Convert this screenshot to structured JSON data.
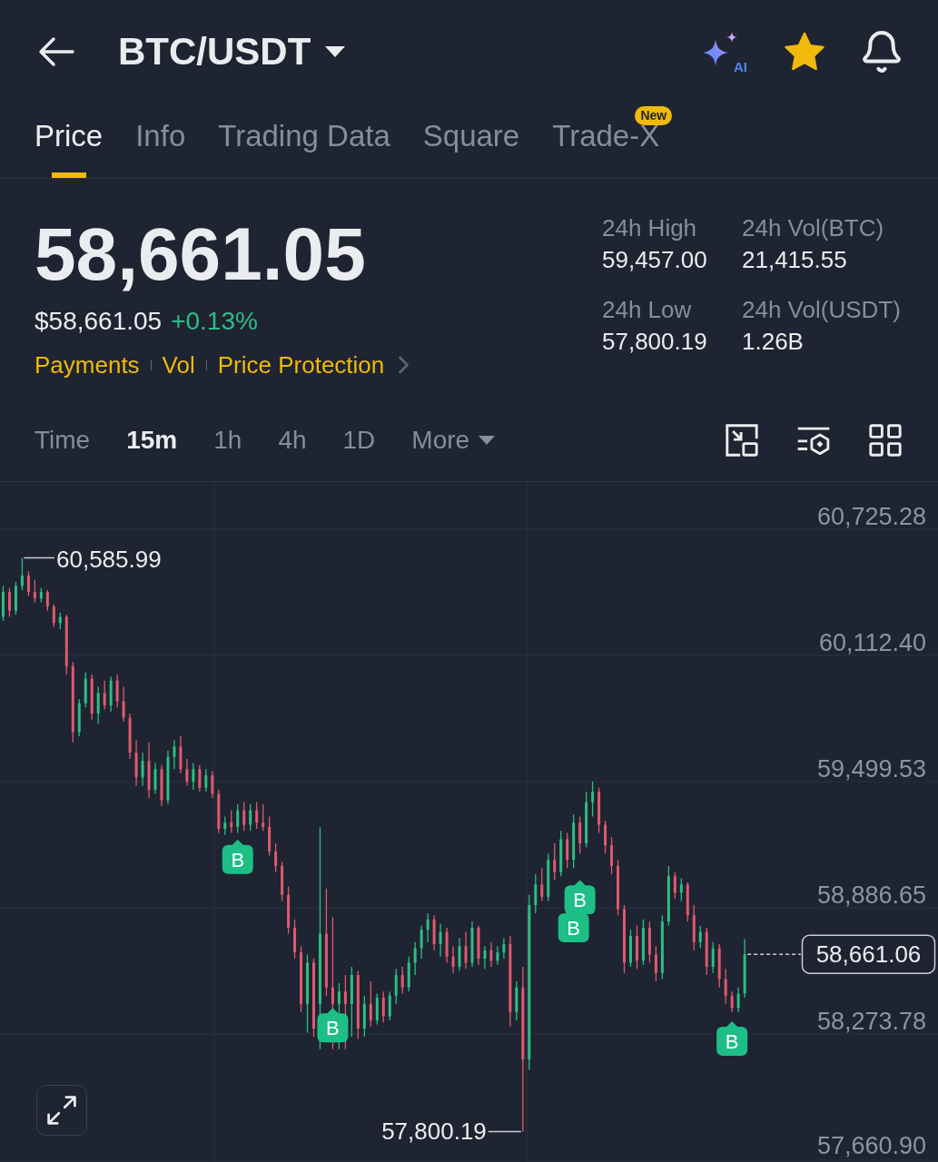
{
  "header": {
    "pair": "BTC/USDT",
    "ai_label": "AI",
    "favorite": true
  },
  "tabs": [
    {
      "label": "Price",
      "selected": true
    },
    {
      "label": "Info",
      "selected": false
    },
    {
      "label": "Trading Data",
      "selected": false
    },
    {
      "label": "Square",
      "selected": false
    },
    {
      "label": "Trade-X",
      "selected": false,
      "badge": "New"
    }
  ],
  "ticker": {
    "last_price": "58,661.05",
    "usd_price": "$58,661.05",
    "change": "+0.13%"
  },
  "links": [
    "Payments",
    "Vol",
    "Price Protection"
  ],
  "stats": [
    {
      "label": "24h High",
      "value": "59,457.00"
    },
    {
      "label": "24h Vol(BTC)",
      "value": "21,415.55"
    },
    {
      "label": "24h Low",
      "value": "57,800.19"
    },
    {
      "label": "24h Vol(USDT)",
      "value": "1.26B"
    }
  ],
  "intervals": [
    {
      "label": "Time",
      "kind": "option",
      "selected": false
    },
    {
      "label": "15m",
      "kind": "option",
      "selected": true
    },
    {
      "label": "1h",
      "kind": "option",
      "selected": false
    },
    {
      "label": "4h",
      "kind": "option",
      "selected": false
    },
    {
      "label": "1D",
      "kind": "option",
      "selected": false
    },
    {
      "label": "More",
      "kind": "menu",
      "selected": false
    }
  ],
  "chart": {
    "chart_data": {
      "type": "candlestick",
      "grid": true,
      "ohlc": [
        [
          60300,
          60450,
          60280,
          60420
        ],
        [
          60420,
          60440,
          60300,
          60330
        ],
        [
          60330,
          60470,
          60310,
          60450
        ],
        [
          60450,
          60585.99,
          60430,
          60500
        ],
        [
          60500,
          60520,
          60400,
          60420
        ],
        [
          60420,
          60480,
          60370,
          60390
        ],
        [
          60390,
          60440,
          60370,
          60420
        ],
        [
          60420,
          60430,
          60330,
          60350
        ],
        [
          60350,
          60360,
          60250,
          60270
        ],
        [
          60270,
          60320,
          60240,
          60300
        ],
        [
          60300,
          60310,
          60020,
          60060
        ],
        [
          60060,
          60080,
          59690,
          59740
        ],
        [
          59740,
          59900,
          59720,
          59880
        ],
        [
          59880,
          60030,
          59860,
          60000
        ],
        [
          60000,
          60020,
          59800,
          59830
        ],
        [
          59830,
          59960,
          59780,
          59930
        ],
        [
          59930,
          59990,
          59850,
          59870
        ],
        [
          59870,
          60010,
          59840,
          59990
        ],
        [
          59990,
          60020,
          59860,
          59890
        ],
        [
          59890,
          59960,
          59790,
          59810
        ],
        [
          59810,
          59830,
          59610,
          59640
        ],
        [
          59640,
          59700,
          59480,
          59520
        ],
        [
          59520,
          59640,
          59480,
          59600
        ],
        [
          59600,
          59690,
          59420,
          59460
        ],
        [
          59460,
          59590,
          59440,
          59560
        ],
        [
          59560,
          59580,
          59380,
          59410
        ],
        [
          59410,
          59650,
          59390,
          59620
        ],
        [
          59620,
          59700,
          59560,
          59670
        ],
        [
          59670,
          59720,
          59540,
          59560
        ],
        [
          59560,
          59610,
          59480,
          59500
        ],
        [
          59500,
          59590,
          59460,
          59560
        ],
        [
          59560,
          59580,
          59450,
          59470
        ],
        [
          59470,
          59560,
          59450,
          59530
        ],
        [
          59530,
          59550,
          59420,
          59440
        ],
        [
          59440,
          59460,
          59250,
          59270
        ],
        [
          59270,
          59330,
          59240,
          59300
        ],
        [
          59300,
          59360,
          59250,
          59280
        ],
        [
          59280,
          59390,
          59250,
          59360
        ],
        [
          59360,
          59400,
          59260,
          59290
        ],
        [
          59290,
          59390,
          59260,
          59360
        ],
        [
          59360,
          59400,
          59270,
          59300
        ],
        [
          59300,
          59390,
          59260,
          59280
        ],
        [
          59280,
          59330,
          59140,
          59160
        ],
        [
          59160,
          59200,
          59060,
          59090
        ],
        [
          59090,
          59110,
          58920,
          58950
        ],
        [
          58950,
          58990,
          58760,
          58790
        ],
        [
          58790,
          58830,
          58640,
          58670
        ],
        [
          58670,
          58700,
          58380,
          58420
        ],
        [
          58420,
          58660,
          58280,
          58620
        ],
        [
          58620,
          58640,
          58260,
          58300
        ],
        [
          58420,
          59278,
          58200,
          58760
        ],
        [
          58760,
          58980,
          58460,
          58500
        ],
        [
          58500,
          58840,
          58200,
          58420
        ],
        [
          58420,
          58520,
          58200,
          58480
        ],
        [
          58480,
          58560,
          58200,
          58420
        ],
        [
          58420,
          58600,
          58260,
          58560
        ],
        [
          58560,
          58580,
          58250,
          58300
        ],
        [
          58300,
          58460,
          58260,
          58420
        ],
        [
          58420,
          58530,
          58310,
          58340
        ],
        [
          58340,
          58470,
          58320,
          58450
        ],
        [
          58450,
          58480,
          58330,
          58360
        ],
        [
          58360,
          58480,
          58340,
          58460
        ],
        [
          58460,
          58590,
          58420,
          58560
        ],
        [
          58560,
          58600,
          58470,
          58500
        ],
        [
          58500,
          58650,
          58480,
          58620
        ],
        [
          58620,
          58720,
          58560,
          58690
        ],
        [
          58690,
          58800,
          58640,
          58780
        ],
        [
          58780,
          58860,
          58720,
          58830
        ],
        [
          58830,
          58850,
          58680,
          58710
        ],
        [
          58710,
          58810,
          58650,
          58770
        ],
        [
          58770,
          58790,
          58620,
          58650
        ],
        [
          58650,
          58700,
          58570,
          58600
        ],
        [
          58600,
          58740,
          58580,
          58700
        ],
        [
          58700,
          58770,
          58590,
          58620
        ],
        [
          58620,
          58820,
          58600,
          58790
        ],
        [
          58790,
          58800,
          58610,
          58640
        ],
        [
          58640,
          58700,
          58590,
          58680
        ],
        [
          58680,
          58720,
          58600,
          58630
        ],
        [
          58630,
          58700,
          58610,
          58670
        ],
        [
          58670,
          58740,
          58640,
          58710
        ],
        [
          58710,
          58750,
          58310,
          58380
        ],
        [
          58380,
          58530,
          58340,
          58500
        ],
        [
          58500,
          58600,
          57800.19,
          58150
        ],
        [
          58150,
          58950,
          58100,
          58900
        ],
        [
          58900,
          59050,
          58860,
          59000
        ],
        [
          59000,
          59080,
          58920,
          58940
        ],
        [
          58940,
          59150,
          58920,
          59120
        ],
        [
          59120,
          59200,
          59020,
          59060
        ],
        [
          59060,
          59260,
          59040,
          59220
        ],
        [
          59220,
          59250,
          59080,
          59120
        ],
        [
          59120,
          59340,
          59080,
          59300
        ],
        [
          59300,
          59330,
          59150,
          59200
        ],
        [
          59200,
          59450,
          59180,
          59400
        ],
        [
          59400,
          59500,
          59330,
          59450
        ],
        [
          59450,
          59470,
          59250,
          59290
        ],
        [
          59290,
          59310,
          59150,
          59190
        ],
        [
          59190,
          59230,
          59050,
          59090
        ],
        [
          59090,
          59120,
          58850,
          58880
        ],
        [
          58880,
          58900,
          58570,
          58620
        ],
        [
          58620,
          58780,
          58600,
          58750
        ],
        [
          58750,
          58800,
          58590,
          58630
        ],
        [
          58630,
          58830,
          58610,
          58790
        ],
        [
          58790,
          58820,
          58620,
          58660
        ],
        [
          58660,
          58700,
          58530,
          58570
        ],
        [
          58570,
          58850,
          58540,
          58820
        ],
        [
          58820,
          59090,
          58800,
          59040
        ],
        [
          59040,
          59060,
          58930,
          58960
        ],
        [
          58960,
          59030,
          58920,
          59000
        ],
        [
          59000,
          59010,
          58820,
          58850
        ],
        [
          58850,
          58900,
          58680,
          58720
        ],
        [
          58720,
          58800,
          58690,
          58770
        ],
        [
          58770,
          58790,
          58560,
          58600
        ],
        [
          58600,
          58720,
          58570,
          58690
        ],
        [
          58690,
          58710,
          58500,
          58540
        ],
        [
          58540,
          58590,
          58420,
          58460
        ],
        [
          58460,
          58480,
          58380,
          58400
        ],
        [
          58400,
          58500,
          58380,
          58470
        ],
        [
          58470,
          58735,
          58450,
          58661.06
        ],
        null,
        null,
        null,
        null,
        null,
        null,
        null,
        null,
        null,
        null,
        null,
        null,
        null,
        null,
        null,
        null,
        null,
        null,
        null,
        null,
        null,
        null,
        null,
        null,
        null,
        null,
        null,
        null,
        null,
        null
      ],
      "ylim": [
        57652.06,
        63295.85
      ],
      "yticks": [
        {
          "value": 60725.28,
          "label": "60,725.28"
        },
        {
          "value": 60112.4,
          "label": "60,112.40"
        },
        {
          "value": 59499.53,
          "label": "59,499.53"
        },
        {
          "value": 58886.65,
          "label": "58,886.65"
        },
        {
          "value": 58273.78,
          "label": "58,273.78"
        },
        {
          "value": 57660.9,
          "label": "57,660.90"
        }
      ]
    },
    "high_label": "60,585.99",
    "low_label": "57,800.19",
    "last_price_tag": "58,661.06",
    "markers": [
      "B",
      "B",
      "B",
      "B",
      "B"
    ]
  }
}
